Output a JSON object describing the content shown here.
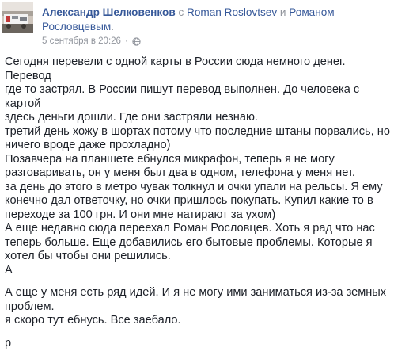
{
  "post": {
    "author": "Александр Шелковенков",
    "with_word": "с",
    "tagged_1": "Roman Roslovtsev",
    "and_word": "и",
    "tagged_2_part1": "Романом",
    "tagged_2_part2": "Рословцевым",
    "period": ".",
    "timestamp": "5 сентября в 20:26",
    "separator": "·",
    "privacy_icon": "globe-icon",
    "paragraphs": [
      "Сегодня перевели с одной карты в России сюда немного денег. Перевод\nгде то застрял. В России пишут перевод выполнен. До человека с картой\nздесь деньги дошли. Где они застряли незнаю.\nтретий день хожу в шортах потому что последние штаны порвались, но\nничего вроде даже прохладно)\nПозавчера на планшете ебнулся микрафон, теперь я не могу\nразговаривать, он у меня был два в одном, телефона у меня нет.\nза день до этого в метро чувак толкнул и очки упали на рельсы. Я ему\nконечно дал ответочку, но очки пришлось покупать. Купил какие то в\nпереходе за 100 грн. И они мне натирают за ухом)\nА еще недавно сюда переехал Роман Рословцев. Хоть я рад что нас\nтеперь больше. Еще добавились его бытовые проблемы. Которые я\nхотел бы чтобы они решились.\nА",
      "А еще у меня есть ряд идей. И я не могу ими заниматься из-за земных\nпроблем.\nя скоро тут ебнусь. Все заебало.",
      "р"
    ]
  },
  "colors": {
    "link": "#365899",
    "text": "#1d2129",
    "meta": "#90949c"
  }
}
